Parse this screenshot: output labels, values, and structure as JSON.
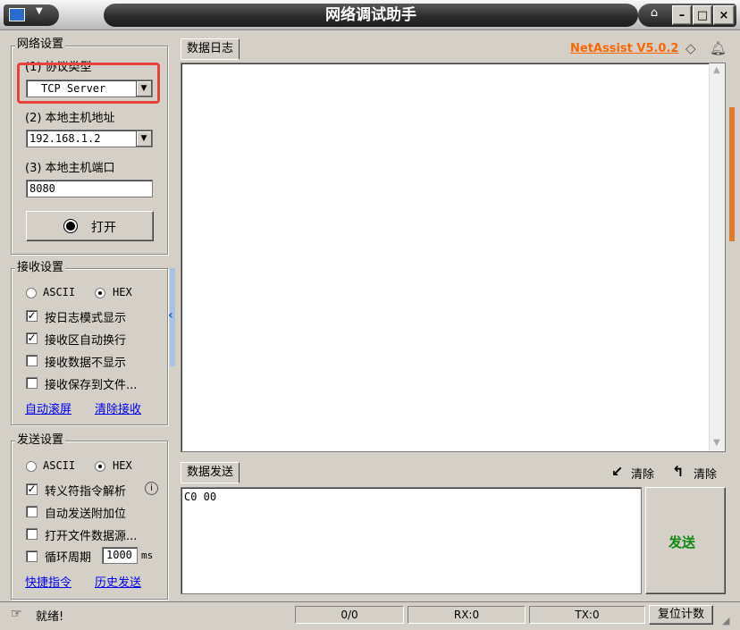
{
  "window": {
    "title": "网络调试助手",
    "buttons": {
      "minimize": "–",
      "maximize": "□",
      "close": "×"
    }
  },
  "network_settings": {
    "legend": "网络设置",
    "protocol_label": "(1) 协议类型",
    "protocol_value": "TCP Server",
    "host_label": "(2) 本地主机地址",
    "host_value": "192.168.1.2",
    "port_label": "(3) 本地主机端口",
    "port_value": "8080",
    "open_button": "打开"
  },
  "receive_settings": {
    "legend": "接收设置",
    "ascii_label": "ASCII",
    "hex_label": "HEX",
    "mode": "HEX",
    "options": [
      {
        "label": "按日志模式显示",
        "checked": true
      },
      {
        "label": "接收区自动换行",
        "checked": true
      },
      {
        "label": "接收数据不显示",
        "checked": false
      },
      {
        "label": "接收保存到文件...",
        "checked": false
      }
    ],
    "auto_scroll_link": "自动滚屏",
    "clear_receive_link": "清除接收"
  },
  "send_settings": {
    "legend": "发送设置",
    "ascii_label": "ASCII",
    "hex_label": "HEX",
    "mode": "HEX",
    "options": [
      {
        "label": "转义符指令解析",
        "checked": true
      },
      {
        "label": "自动发送附加位",
        "checked": false
      },
      {
        "label": "打开文件数据源...",
        "checked": false
      },
      {
        "label": "循环周期",
        "checked": false
      }
    ],
    "period_value": "1000",
    "period_unit": "ms",
    "shortcut_link": "快捷指令",
    "history_link": "历史发送"
  },
  "log_panel": {
    "tab_label": "数据日志",
    "version": "NetAssist V5.0.2",
    "content": ""
  },
  "send_panel": {
    "tab_label": "数据发送",
    "clear_label_1": "清除",
    "clear_label_2": "清除",
    "content": "C0 00",
    "send_button": "发送"
  },
  "status_bar": {
    "status_text": "就绪!",
    "counter": "0/0",
    "rx": "RX:0",
    "tx": "TX:0",
    "reset_button": "复位计数"
  },
  "colors": {
    "highlight_box": "#e8403a",
    "version_text": "#ff6600",
    "send_button_text": "#118811",
    "link": "#0000ee",
    "scrollbar_accent": "#e07b2a"
  }
}
